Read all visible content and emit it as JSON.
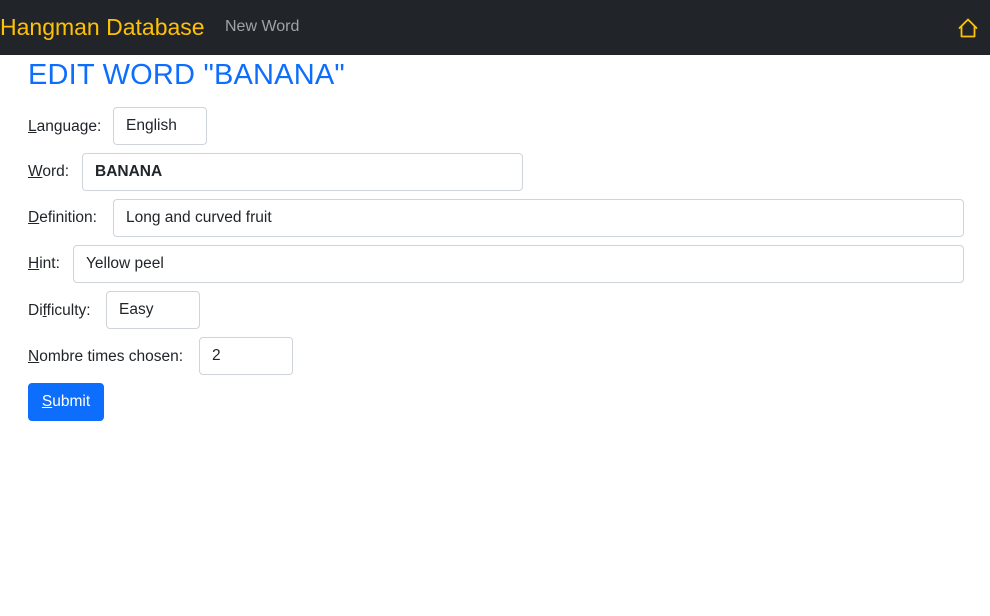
{
  "navbar": {
    "brand": "Hangman Database",
    "new_word_link": "New Word",
    "home_icon": "home-icon"
  },
  "page": {
    "title": "EDIT WORD \"BANANA\""
  },
  "form": {
    "language": {
      "label_access": "L",
      "label_rest": "anguage:",
      "value": "English"
    },
    "word": {
      "label_access": "W",
      "label_rest": "ord:",
      "value": "BANANA"
    },
    "definition": {
      "label_access": "D",
      "label_rest": "efinition:",
      "value": "Long and curved fruit"
    },
    "hint": {
      "label_access": "H",
      "label_rest": "int:",
      "value": "Yellow peel"
    },
    "difficulty": {
      "label_pre": "Di",
      "label_access": "f",
      "label_rest": "ficulty:",
      "value": "Easy"
    },
    "times_chosen": {
      "label_access": "N",
      "label_rest": "ombre times chosen:",
      "value": "2"
    },
    "submit": {
      "label_access": "S",
      "label_rest": "ubmit"
    }
  },
  "colors": {
    "navbar_bg": "#212529",
    "brand": "#ffc107",
    "title": "#0d6efd",
    "button": "#0d6efd"
  }
}
